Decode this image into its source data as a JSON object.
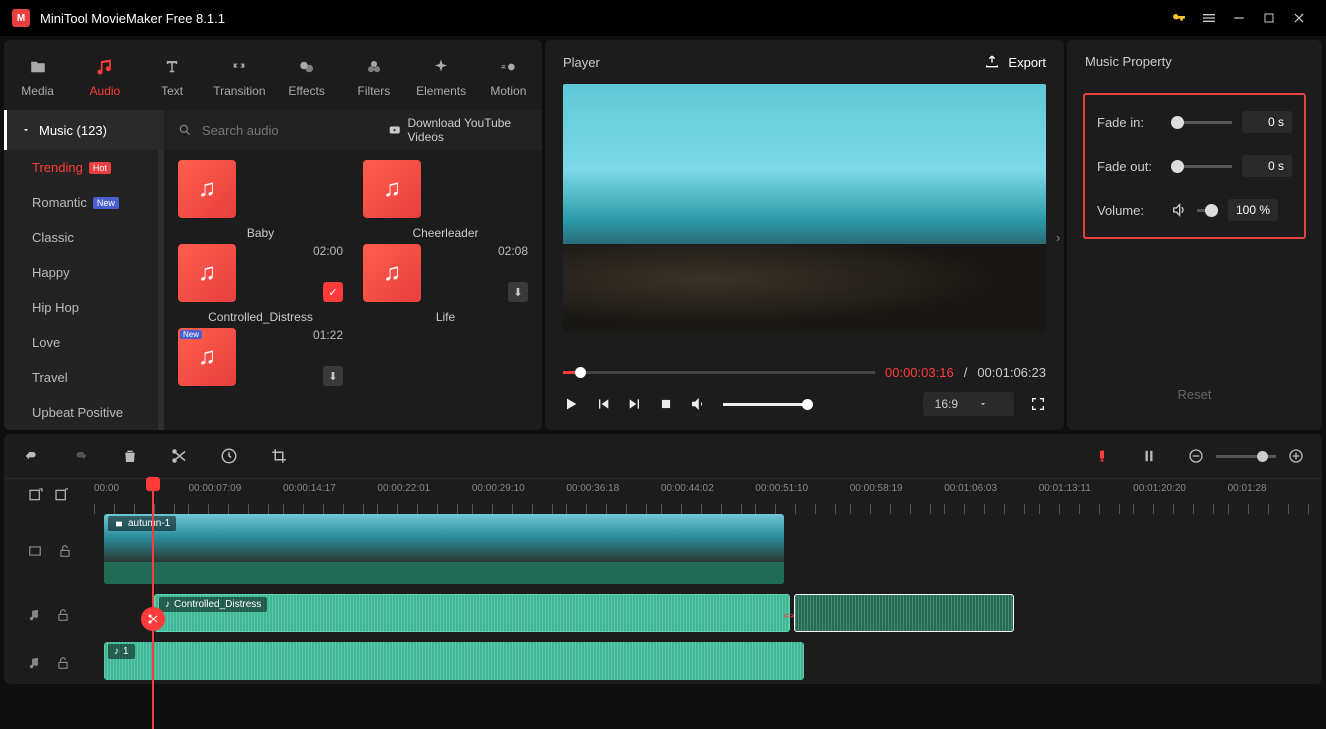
{
  "app": {
    "title": "MiniTool MovieMaker Free 8.1.1"
  },
  "tabs": [
    {
      "label": "Media"
    },
    {
      "label": "Audio"
    },
    {
      "label": "Text"
    },
    {
      "label": "Transition"
    },
    {
      "label": "Effects"
    },
    {
      "label": "Filters"
    },
    {
      "label": "Elements"
    },
    {
      "label": "Motion"
    }
  ],
  "music_header": "Music (123)",
  "search": {
    "placeholder": "Search audio"
  },
  "yt_link": "Download YouTube Videos",
  "sidebar": {
    "items": [
      {
        "label": "Trending",
        "badge": "Hot"
      },
      {
        "label": "Romantic",
        "badge": "New"
      },
      {
        "label": "Classic"
      },
      {
        "label": "Happy"
      },
      {
        "label": "Hip Hop"
      },
      {
        "label": "Love"
      },
      {
        "label": "Travel"
      },
      {
        "label": "Upbeat Positive"
      }
    ]
  },
  "audio_items": [
    {
      "name": "Baby",
      "dur": ""
    },
    {
      "name": "Cheerleader",
      "dur": ""
    },
    {
      "name": "Controlled_Distress",
      "dur": "02:00",
      "checked": true
    },
    {
      "name": "Life",
      "dur": "02:08",
      "dl": true
    },
    {
      "name": "",
      "dur": "01:22",
      "new": true,
      "dl": true
    }
  ],
  "player": {
    "title": "Player",
    "export": "Export",
    "aspect": "16:9",
    "time_current": "00:00:03:16",
    "time_sep": "/",
    "time_total": "00:01:06:23"
  },
  "props": {
    "title": "Music Property",
    "fade_in_label": "Fade in:",
    "fade_in_value": "0 s",
    "fade_out_label": "Fade out:",
    "fade_out_value": "0 s",
    "volume_label": "Volume:",
    "volume_value": "100 %",
    "reset": "Reset"
  },
  "ruler": [
    "00:00",
    "00:00:07:09",
    "00:00:14:17",
    "00:00:22:01",
    "00:00:29:10",
    "00:00:36:18",
    "00:00:44:02",
    "00:00:51:10",
    "00:00:58:19",
    "00:01:06:03",
    "00:01:13:11",
    "00:01:20:20",
    "00:01:28"
  ],
  "clips": {
    "video": "autumn-1",
    "audio1": "Controlled_Distress",
    "audio2": "1"
  }
}
